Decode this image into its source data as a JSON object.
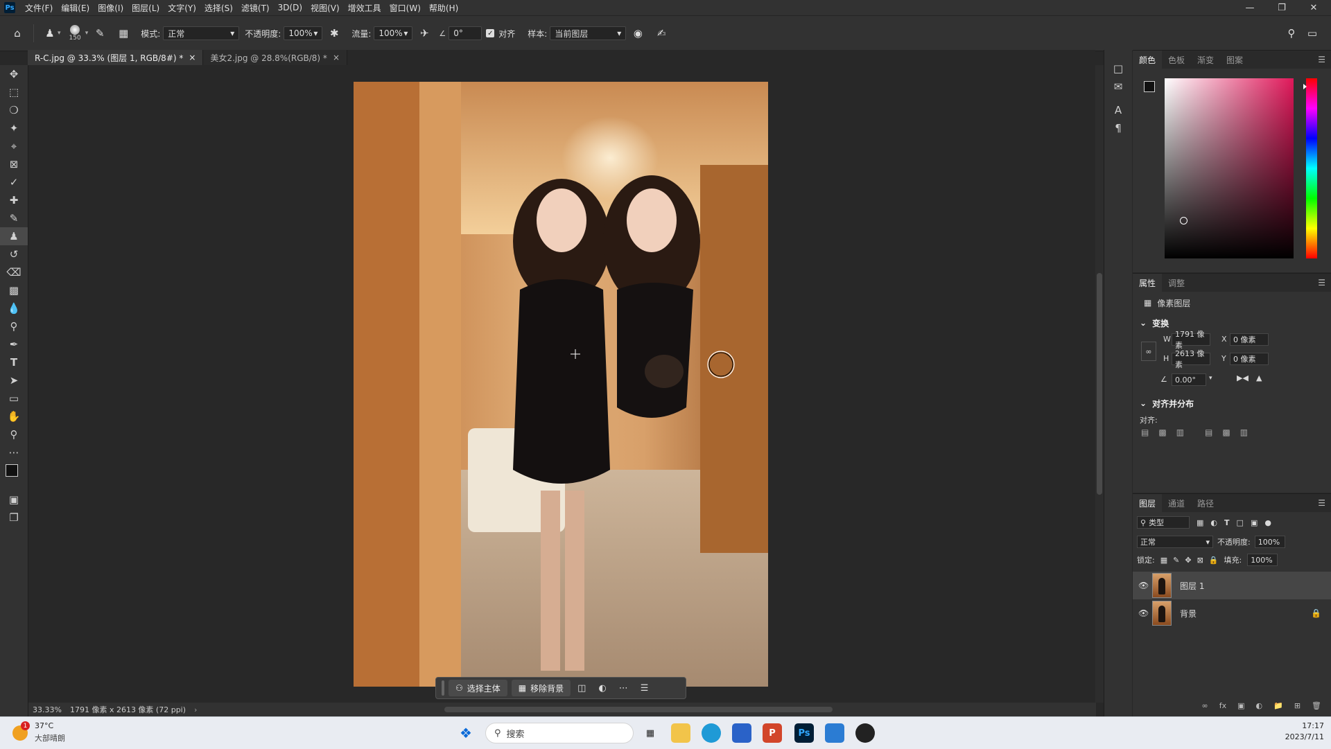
{
  "menu": [
    "文件(F)",
    "编辑(E)",
    "图像(I)",
    "图层(L)",
    "文字(Y)",
    "选择(S)",
    "滤镜(T)",
    "3D(D)",
    "视图(V)",
    "增效工具",
    "窗口(W)",
    "帮助(H)"
  ],
  "app_logo": "Ps",
  "options": {
    "brush_size": "150",
    "mode_label": "模式:",
    "mode_value": "正常",
    "opacity_label": "不透明度:",
    "opacity_value": "100%",
    "flow_label": "流量:",
    "flow_value": "100%",
    "angle_value": "0°",
    "align_label": "对齐",
    "sample_label": "样本:",
    "sample_value": "当前图层"
  },
  "tabs": [
    {
      "label": "R-C.jpg @ 33.3% (图层 1, RGB/8#) *",
      "active": true
    },
    {
      "label": "美女2.jpg @ 28.8%(RGB/8) *",
      "active": false
    }
  ],
  "status": {
    "zoom": "33.33%",
    "doc_info": "1791 像素 x 2613 像素 (72 ppi)"
  },
  "context_bar": {
    "select_subject": "选择主体",
    "remove_bg": "移除背景"
  },
  "color_panel": {
    "tabs": [
      "颜色",
      "色板",
      "渐变",
      "图案"
    ],
    "hue_color": "#e0185a"
  },
  "properties_panel": {
    "tabs": [
      "属性",
      "调整"
    ],
    "layer_type": "像素图层",
    "transform_title": "变换",
    "w_label": "W",
    "w_value": "1791 像素",
    "h_label": "H",
    "h_value": "2613 像素",
    "x_label": "X",
    "x_value": "0 像素",
    "y_label": "Y",
    "y_value": "0 像素",
    "angle_value": "0.00°",
    "align_title": "对齐并分布",
    "align_label": "对齐:"
  },
  "layers_panel": {
    "tabs": [
      "图层",
      "通道",
      "路径"
    ],
    "filter_label": "类型",
    "blend_mode": "正常",
    "opacity_label": "不透明度:",
    "opacity_value": "100%",
    "lock_label": "锁定:",
    "fill_label": "填充:",
    "fill_value": "100%",
    "layers": [
      {
        "name": "图层 1",
        "selected": true,
        "locked": false
      },
      {
        "name": "背景",
        "selected": false,
        "locked": true
      }
    ]
  },
  "taskbar": {
    "weather_temp": "37°C",
    "weather_desc": "大部晴朗",
    "weather_badge": "1",
    "search_label": "搜索",
    "time": "17:17",
    "date": "2023/7/11"
  }
}
